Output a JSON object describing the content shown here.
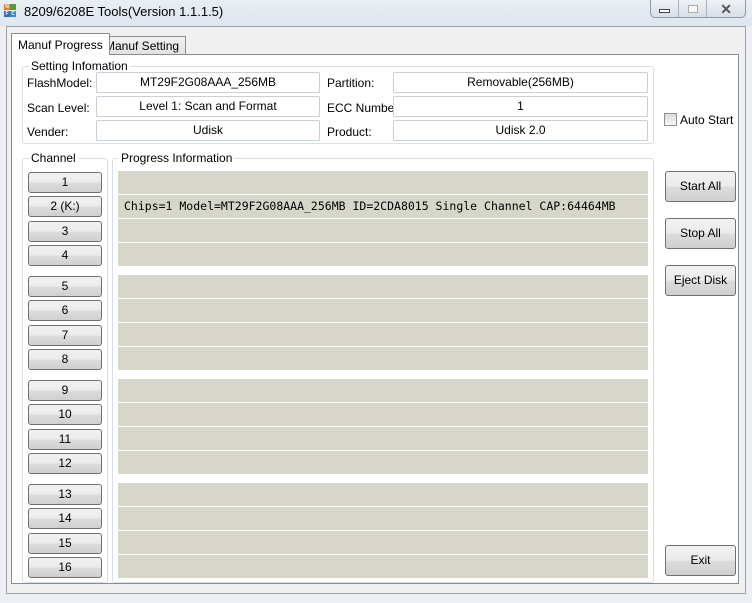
{
  "window": {
    "title": "8209/6208E Tools(Version 1.1.1.5)",
    "controls": {
      "minimize": "minimize",
      "maximize": "maximize",
      "close": "close"
    }
  },
  "tabs": [
    {
      "label": "Manuf Progress",
      "active": true
    },
    {
      "label": "Manuf Setting",
      "active": false
    }
  ],
  "setting_info": {
    "group_label": "Setting Infomation",
    "flash_model_label": "FlashModel:",
    "flash_model_value": "MT29F2G08AAA_256MB",
    "scan_level_label": "Scan Level:",
    "scan_level_value": "Level 1: Scan and Format",
    "vender_label": "Vender:",
    "vender_value": "Udisk",
    "partition_label": "Partition:",
    "partition_value": "Removable(256MB)",
    "ecc_label": "ECC Number:",
    "ecc_value": "1",
    "product_label": "Product:",
    "product_value": "Udisk 2.0"
  },
  "auto_start": {
    "label": "Auto Start",
    "checked": false
  },
  "channel": {
    "group_label": "Channel",
    "buttons": [
      "1",
      "2 (K:)",
      "3",
      "4",
      "5",
      "6",
      "7",
      "8",
      "9",
      "10",
      "11",
      "12",
      "13",
      "14",
      "15",
      "16"
    ]
  },
  "progress": {
    "group_label": "Progress Information",
    "rows": [
      "",
      "Chips=1 Model=MT29F2G08AAA_256MB ID=2CDA8015 Single Channel CAP:64464MB",
      "",
      "",
      "",
      "",
      "",
      "",
      "",
      "",
      "",
      "",
      "",
      "",
      "",
      ""
    ],
    "row_color": "#d6d6cb"
  },
  "actions": {
    "start_all": "Start All",
    "stop_all": "Stop All",
    "eject_disk": "Eject Disk",
    "exit": "Exit"
  }
}
